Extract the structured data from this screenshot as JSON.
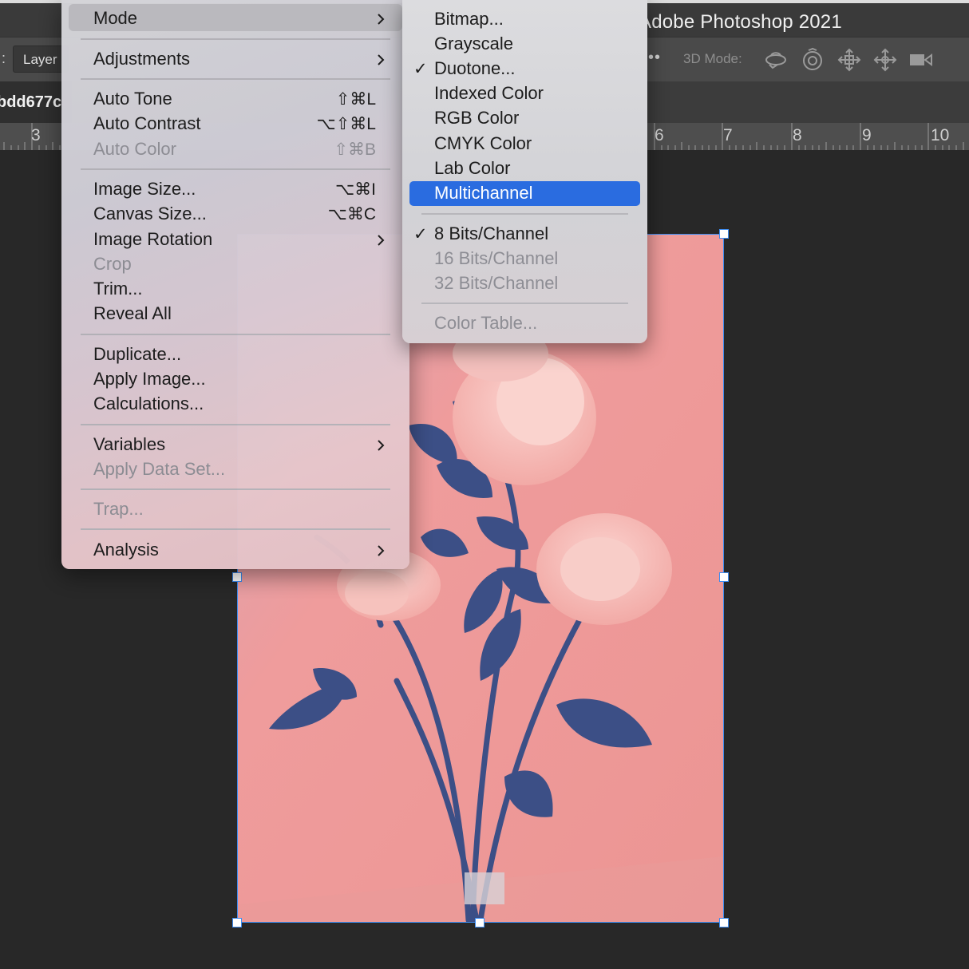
{
  "app": {
    "title": "Adobe Photoshop 2021"
  },
  "options_bar": {
    "colon": ":",
    "layer_select_value": "Layer",
    "more": "••",
    "mode3d_label": "3D Mode:",
    "tools3d": [
      "orbit-3d-icon",
      "roll-3d-icon",
      "pan-3d-icon",
      "slide-3d-icon",
      "scale-3d-icon"
    ]
  },
  "document": {
    "tab_title": "bdd677c"
  },
  "ruler": {
    "numbers": [
      "3",
      "6",
      "7",
      "8",
      "9",
      "10"
    ]
  },
  "image_menu": {
    "mode": {
      "label": "Mode"
    },
    "adjustments": {
      "label": "Adjustments"
    },
    "auto_tone": {
      "label": "Auto Tone",
      "shortcut": "⇧⌘L"
    },
    "auto_contrast": {
      "label": "Auto Contrast",
      "shortcut": "⌥⇧⌘L"
    },
    "auto_color": {
      "label": "Auto Color",
      "shortcut": "⇧⌘B"
    },
    "image_size": {
      "label": "Image Size...",
      "shortcut": "⌥⌘I"
    },
    "canvas_size": {
      "label": "Canvas Size...",
      "shortcut": "⌥⌘C"
    },
    "image_rotation": {
      "label": "Image Rotation"
    },
    "crop": {
      "label": "Crop"
    },
    "trim": {
      "label": "Trim..."
    },
    "reveal_all": {
      "label": "Reveal All"
    },
    "duplicate": {
      "label": "Duplicate..."
    },
    "apply_image": {
      "label": "Apply Image..."
    },
    "calculations": {
      "label": "Calculations..."
    },
    "variables": {
      "label": "Variables"
    },
    "apply_data_set": {
      "label": "Apply Data Set..."
    },
    "trap": {
      "label": "Trap..."
    },
    "analysis": {
      "label": "Analysis"
    }
  },
  "mode_submenu": {
    "check_mark": "✓",
    "bitmap": "Bitmap...",
    "grayscale": "Grayscale",
    "duotone": "Duotone...",
    "indexed_color": "Indexed Color",
    "rgb_color": "RGB Color",
    "cmyk_color": "CMYK Color",
    "lab_color": "Lab Color",
    "multichannel": "Multichannel",
    "bits8": "8 Bits/Channel",
    "bits16": "16 Bits/Channel",
    "bits32": "32 Bits/Channel",
    "color_table": "Color Table...",
    "checked": [
      "Duotone...",
      "8 Bits/Channel"
    ],
    "highlighted": "Multichannel"
  },
  "colors": {
    "highlight": "#2a6ce0",
    "transform_frame": "#3d8cf0",
    "duotone_light": "#ee9e9c",
    "duotone_dark": "#3c4f86"
  }
}
